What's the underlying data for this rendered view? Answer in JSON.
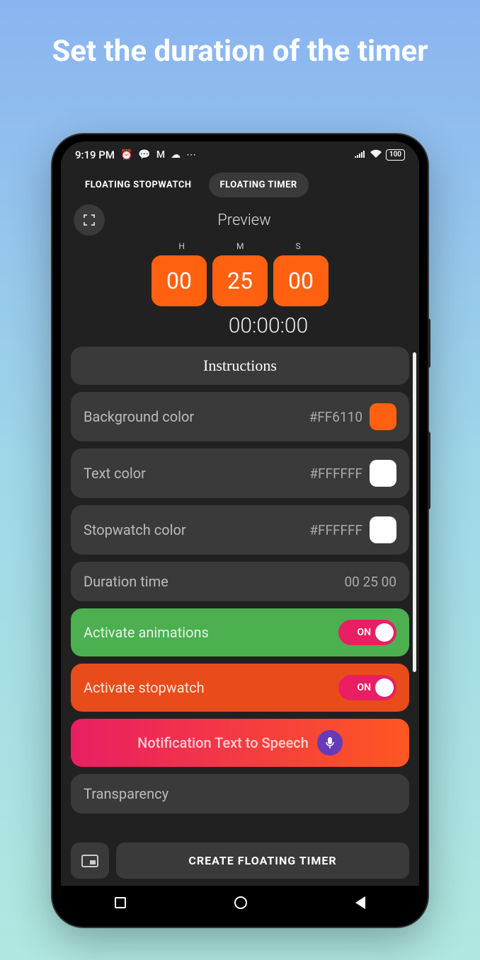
{
  "promo_title": "Set the duration of the timer",
  "status": {
    "time": "9:19 PM",
    "battery": "100"
  },
  "tabs": {
    "stopwatch": "FLOATING STOPWATCH",
    "timer": "FLOATING TIMER"
  },
  "preview": {
    "label": "Preview",
    "headers": {
      "h": "H",
      "m": "M",
      "s": "S"
    },
    "hours": "00",
    "minutes": "25",
    "seconds": "00",
    "counter": "00:00:00"
  },
  "settings": {
    "instructions_label": "Instructions",
    "bg_color": {
      "label": "Background color",
      "value": "#FF6110",
      "swatch": "#FF6110"
    },
    "text_color": {
      "label": "Text color",
      "value": "#FFFFFF",
      "swatch": "#FFFFFF"
    },
    "stopwatch_color": {
      "label": "Stopwatch color",
      "value": "#FFFFFF",
      "swatch": "#FFFFFF"
    },
    "duration": {
      "label": "Duration time",
      "value": "00 25 00"
    },
    "animations": {
      "label": "Activate animations",
      "state": "ON"
    },
    "stopwatch": {
      "label": "Activate stopwatch",
      "state": "ON"
    },
    "tts": {
      "label": "Notification Text to Speech"
    },
    "transparency": {
      "label": "Transparency"
    }
  },
  "create_button": "CREATE FLOATING TIMER"
}
